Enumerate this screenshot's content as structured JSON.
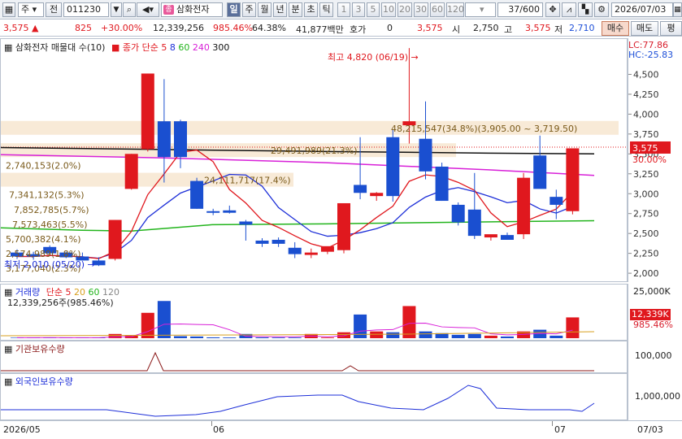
{
  "toolbar": {
    "market": "주",
    "prev_label": "전",
    "code": "011230",
    "stock_badge": "종",
    "stock_name": "삼화전자",
    "periods": [
      "일",
      "주",
      "월",
      "년",
      "분",
      "초",
      "틱"
    ],
    "active_period": "일",
    "intervals": [
      "1",
      "3",
      "5",
      "10",
      "20",
      "30",
      "60",
      "120"
    ],
    "counter": "37/600",
    "date": "2026/07/03"
  },
  "quote": {
    "price": "3,575",
    "change": "825",
    "change_pct": "+30.00%",
    "volume": "12,339,256",
    "volume_ratio": "985.46%",
    "turnover_ratio": "64.38%",
    "amount": "41,877백만",
    "hoga_label": "호가",
    "hoga_value": "0",
    "ask": "3,575",
    "open_label": "시",
    "open": "2,750",
    "high_label": "고",
    "high": "3,575",
    "low_label": "저",
    "low": "2,710",
    "buy_label": "매수",
    "sell_label": "매도",
    "eval_label": "평"
  },
  "price_panel": {
    "title": "삼화전자 매물대 수(10)",
    "ma_label": "종가 단순",
    "ma_periods": [
      "5",
      "8",
      "60",
      "240",
      "300"
    ],
    "ma_colors": [
      "#e0181e",
      "#1d2fd8",
      "#22b41c",
      "#d820d8",
      "#111111"
    ],
    "lc_label": "LC:77.86",
    "hc_label": "HC:-25.83",
    "high_note": "최고 4,820 (06/19)",
    "low_note": "최저 2,010 (05/20)",
    "current_price_tag": "3,575",
    "current_pct_tag": "30.00%",
    "volume_profile": [
      {
        "label": "48,215,547(34.8%)(3,905.00 ~ 3,719.50)",
        "price": 3812
      },
      {
        "label": "29,491,989(21.3%)",
        "price": 3532
      },
      {
        "label": "2,740,153(2.0%)",
        "price": 3345
      },
      {
        "label": "24,111,717(17.4%)",
        "price": 3160
      },
      {
        "label": "7,341,132(5.3%)",
        "price": 2975
      },
      {
        "label": "7,852,785(5.7%)",
        "price": 2790
      },
      {
        "label": "7,573,463(5.5%)",
        "price": 2605
      },
      {
        "label": "5,700,382(4.1%)",
        "price": 2420
      },
      {
        "label": "2,574,989(1.8%)",
        "price": 2235
      },
      {
        "label": "3,177,040(2.3%)",
        "price": 2050
      }
    ],
    "y_ticks": [
      "4,500",
      "4,250",
      "4,000",
      "3,750",
      "3,500",
      "3,250",
      "3,000",
      "2,750",
      "2,500",
      "2,250",
      "2,000"
    ]
  },
  "volume_panel": {
    "title": "거래량",
    "ma_label": "단순",
    "ma_periods": [
      "5",
      "20",
      "60",
      "120"
    ],
    "ma_colors": [
      "#e0181e",
      "#d8a020",
      "#22b41c",
      "#888888"
    ],
    "current": "12,339,256주(985.46%)",
    "y_tick": "25,000K",
    "tag_value": "12,339K",
    "tag_pct": "985.46%"
  },
  "inst_panel": {
    "title": "기관보유수량",
    "y_tick": "100,000"
  },
  "foreign_panel": {
    "title": "외국인보유수량",
    "y_tick": "1,000,000"
  },
  "date_axis": {
    "start": "2026/05",
    "mid1": "06",
    "mid2": "07",
    "end": "07/03"
  },
  "chart_data": {
    "type": "candlestick",
    "ylim": [
      1950,
      4750
    ],
    "candles": [
      {
        "o": 2250,
        "h": 2290,
        "l": 2170,
        "c": 2200,
        "v": 0.3
      },
      {
        "o": 2230,
        "h": 2260,
        "l": 2160,
        "c": 2200,
        "v": 0.3
      },
      {
        "o": 2320,
        "h": 2340,
        "l": 2240,
        "c": 2240,
        "v": 0.4
      },
      {
        "o": 2250,
        "h": 2260,
        "l": 2180,
        "c": 2190,
        "v": 0.3
      },
      {
        "o": 2200,
        "h": 2250,
        "l": 2150,
        "c": 2150,
        "v": 0.3
      },
      {
        "o": 2150,
        "h": 2190,
        "l": 2080,
        "c": 2090,
        "v": 0.3
      },
      {
        "o": 2170,
        "h": 2660,
        "l": 2150,
        "c": 2660,
        "v": 2.5
      },
      {
        "o": 3050,
        "h": 3490,
        "l": 3040,
        "c": 3490,
        "v": 1.5
      },
      {
        "o": 3550,
        "h": 4500,
        "l": 3520,
        "c": 4500,
        "v": 15
      },
      {
        "o": 3900,
        "h": 4430,
        "l": 3130,
        "c": 3450,
        "v": 22
      },
      {
        "o": 3900,
        "h": 3920,
        "l": 3310,
        "c": 3450,
        "v": 1.2
      },
      {
        "o": 3150,
        "h": 3190,
        "l": 2800,
        "c": 2800,
        "v": 1.0
      },
      {
        "o": 2770,
        "h": 2800,
        "l": 2720,
        "c": 2760,
        "v": 0.5
      },
      {
        "o": 2780,
        "h": 2840,
        "l": 2740,
        "c": 2750,
        "v": 0.4
      },
      {
        "o": 2640,
        "h": 2660,
        "l": 2400,
        "c": 2600,
        "v": 2.5
      },
      {
        "o": 2400,
        "h": 2430,
        "l": 2320,
        "c": 2360,
        "v": 0.5
      },
      {
        "o": 2410,
        "h": 2440,
        "l": 2320,
        "c": 2360,
        "v": 0.4
      },
      {
        "o": 2310,
        "h": 2380,
        "l": 2180,
        "c": 2230,
        "v": 0.4
      },
      {
        "o": 2220,
        "h": 2300,
        "l": 2180,
        "c": 2250,
        "v": 2.5
      },
      {
        "o": 2260,
        "h": 2300,
        "l": 2230,
        "c": 2330,
        "v": 0.4
      },
      {
        "o": 2280,
        "h": 2870,
        "l": 2240,
        "c": 2870,
        "v": 3.5
      },
      {
        "o": 3100,
        "h": 3700,
        "l": 2920,
        "c": 3000,
        "v": 14
      },
      {
        "o": 2960,
        "h": 3010,
        "l": 2900,
        "c": 3000,
        "v": 4
      },
      {
        "o": 3700,
        "h": 3790,
        "l": 2890,
        "c": 2960,
        "v": 3.5
      },
      {
        "o": 3850,
        "h": 4820,
        "l": 3620,
        "c": 3900,
        "v": 19
      },
      {
        "o": 3680,
        "h": 4150,
        "l": 3170,
        "c": 3270,
        "v": 4
      },
      {
        "o": 3330,
        "h": 3380,
        "l": 2900,
        "c": 2900,
        "v": 3
      },
      {
        "o": 2850,
        "h": 2880,
        "l": 2590,
        "c": 2630,
        "v": 2
      },
      {
        "o": 2790,
        "h": 3250,
        "l": 2420,
        "c": 2460,
        "v": 2.5
      },
      {
        "o": 2440,
        "h": 2460,
        "l": 2400,
        "c": 2480,
        "v": 1.5
      },
      {
        "o": 2470,
        "h": 2500,
        "l": 2410,
        "c": 2410,
        "v": 1
      },
      {
        "o": 2480,
        "h": 3250,
        "l": 2420,
        "c": 3190,
        "v": 4
      },
      {
        "o": 3470,
        "h": 3720,
        "l": 3080,
        "c": 3050,
        "v": 5
      },
      {
        "o": 2950,
        "h": 3040,
        "l": 2670,
        "c": 2850,
        "v": 1.5
      },
      {
        "o": 2770,
        "h": 3070,
        "l": 2730,
        "c": 3560,
        "v": 12.3
      }
    ]
  }
}
